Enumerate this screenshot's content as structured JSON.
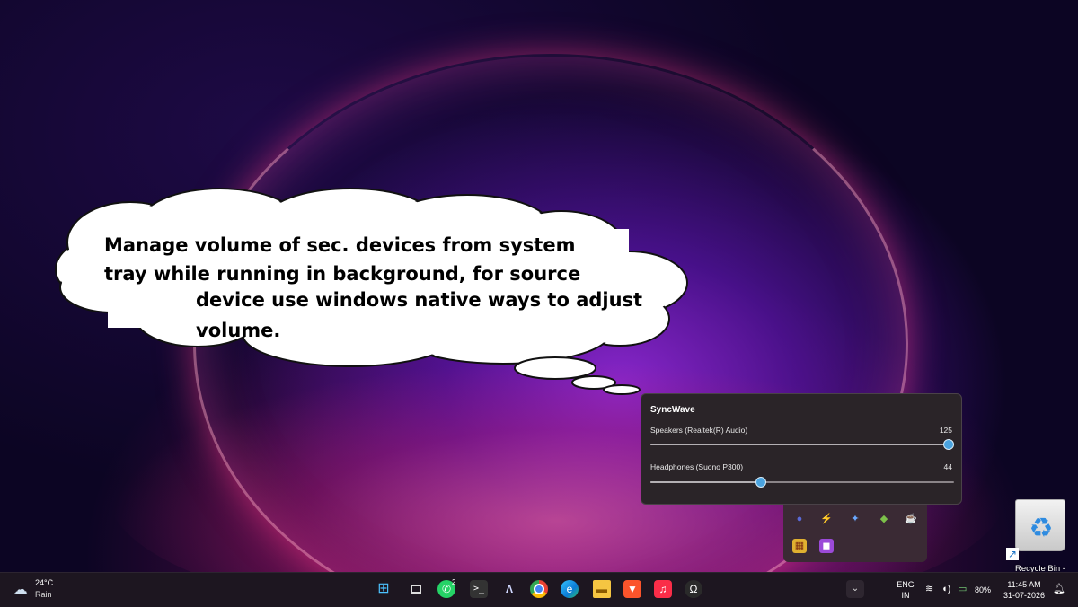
{
  "callout": {
    "line1": "Manage volume of sec. devices from system",
    "line2": "tray while running in background, for source",
    "line3": "device use windows native ways to adjust",
    "line4": "volume."
  },
  "flyout": {
    "title": "SyncWave",
    "devices": [
      {
        "name": "Speakers (Realtek(R) Audio)",
        "value": "125",
        "level": 0.98
      },
      {
        "name": "Headphones (Suono P300)",
        "value": "44",
        "level": 0.36
      }
    ]
  },
  "recycle_bin": {
    "label": "Recycle Bin -"
  },
  "weather": {
    "temp": "24°C",
    "condition": "Rain",
    "icon": "cloud-rain-icon"
  },
  "taskbar": {
    "apps": [
      {
        "name": "start-button",
        "icon": "windows-icon"
      },
      {
        "name": "task-view-button",
        "icon": "task-view-icon"
      },
      {
        "name": "whatsapp-button",
        "icon": "whatsapp-icon",
        "badge": "2"
      },
      {
        "name": "terminal-button",
        "icon": "terminal-icon"
      },
      {
        "name": "app-a-button",
        "icon": "a-logo-icon"
      },
      {
        "name": "chrome-button",
        "icon": "chrome-icon"
      },
      {
        "name": "edge-button",
        "icon": "edge-icon"
      },
      {
        "name": "file-explorer-button",
        "icon": "folder-icon"
      },
      {
        "name": "brave-button",
        "icon": "brave-icon"
      },
      {
        "name": "music-button",
        "icon": "music-icon"
      },
      {
        "name": "headphones-app-button",
        "icon": "headphones-icon"
      }
    ],
    "language": {
      "line1": "ENG",
      "line2": "IN"
    },
    "battery": "80%",
    "time": "11:45 AM",
    "date": "31-07-2026"
  },
  "colors": {
    "accent": "#4aa3df",
    "flyout_bg": "#2a2424",
    "taskbar_bg": "#1d1620"
  }
}
